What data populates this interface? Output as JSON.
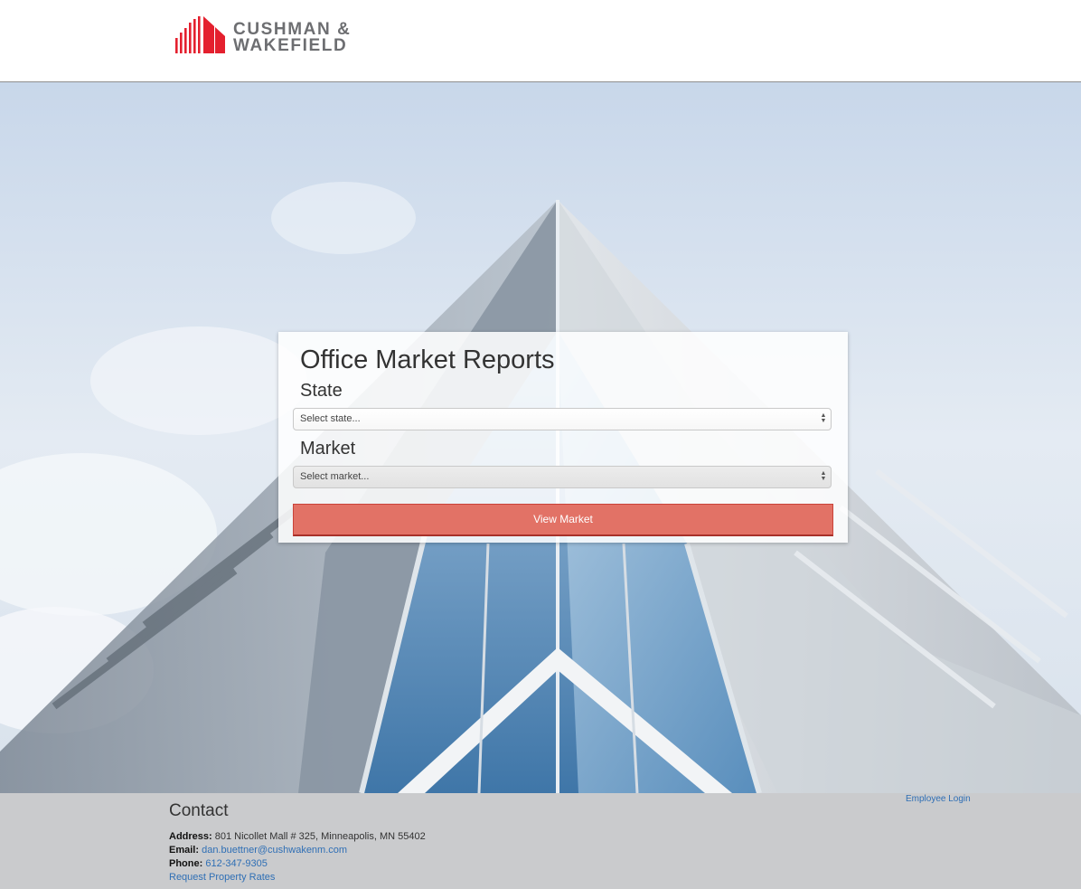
{
  "brand": {
    "line1": "CUSHMAN &",
    "line2": "WAKEFIELD",
    "accent_color": "#e4202e",
    "text_color": "#6d6e71"
  },
  "card": {
    "title": "Office Market Reports",
    "state_label": "State",
    "state_select": {
      "selected": "Select state..."
    },
    "market_label": "Market",
    "market_select": {
      "selected": "Select market..."
    },
    "submit_label": "View Market",
    "button_color": "#e27266"
  },
  "footer": {
    "title": "Contact",
    "address_label": "Address:",
    "address_value": "801 Nicollet Mall # 325, Minneapolis, MN 55402",
    "email_label": "Email:",
    "email_value": "dan.buettner@cushwakenm.com",
    "phone_label": "Phone:",
    "phone_value": "612-347-9305",
    "request_rates": "Request Property Rates",
    "employee_login": "Employee Login",
    "link_color": "#2f6fb5"
  }
}
